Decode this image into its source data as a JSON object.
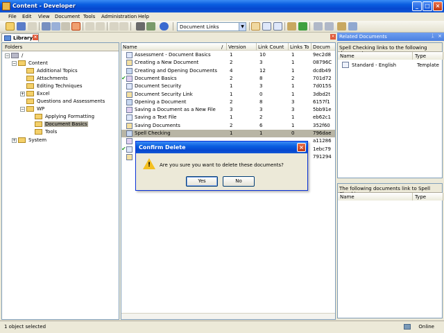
{
  "window": {
    "title": "Content - Developer",
    "controls": {
      "minimize": "_",
      "maximize": "□",
      "close": "×"
    }
  },
  "menu": [
    "File",
    "Edit",
    "View",
    "Document",
    "Tools",
    "Administration",
    "Help"
  ],
  "toolbar": {
    "view_combo": "Document Links",
    "combo_arrow": "▼"
  },
  "library_tab": {
    "label": "Library",
    "close": "×"
  },
  "folders": {
    "header": "Folders",
    "items": [
      {
        "label": "/",
        "expander": "−"
      },
      {
        "label": "Content",
        "expander": "−"
      },
      {
        "label": "Additional Topics",
        "expander": ""
      },
      {
        "label": "Attachments",
        "expander": ""
      },
      {
        "label": "Editing Techniques",
        "expander": ""
      },
      {
        "label": "Excel",
        "expander": "+"
      },
      {
        "label": "Questions and Assessments",
        "expander": ""
      },
      {
        "label": "WP",
        "expander": "−"
      },
      {
        "label": "Applying Formatting",
        "expander": ""
      },
      {
        "label": "Document Basics",
        "expander": ""
      },
      {
        "label": "Tools",
        "expander": ""
      },
      {
        "label": "System",
        "expander": "+"
      }
    ],
    "selected": "Document Basics"
  },
  "documents": {
    "columns": [
      "Name",
      "Version",
      "Link Count",
      "Links To",
      "Docum"
    ],
    "sort_glyph": "/",
    "rows": [
      {
        "name": "Assessment - Document Basics",
        "version": "1",
        "link_count": "10",
        "links_to": "1",
        "doc": "9ec2d8",
        "checked": false
      },
      {
        "name": "Creating a New Document",
        "version": "2",
        "link_count": "3",
        "links_to": "1",
        "doc": "08796C",
        "checked": false
      },
      {
        "name": "Creating and Opening Documents",
        "version": "4",
        "link_count": "12",
        "links_to": "1",
        "doc": "dcdb49",
        "checked": false
      },
      {
        "name": "Document Basics",
        "version": "2",
        "link_count": "8",
        "links_to": "2",
        "doc": "701d72",
        "checked": true
      },
      {
        "name": "Document Security",
        "version": "1",
        "link_count": "3",
        "links_to": "1",
        "doc": "7d015S",
        "checked": false
      },
      {
        "name": "Document Security Link",
        "version": "1",
        "link_count": "0",
        "links_to": "1",
        "doc": "3dbd2t",
        "checked": false
      },
      {
        "name": "Opening a Document",
        "version": "2",
        "link_count": "8",
        "links_to": "3",
        "doc": "6157f1",
        "checked": false
      },
      {
        "name": "Saving a Document as a New File",
        "version": "3",
        "link_count": "3",
        "links_to": "3",
        "doc": "5bb91e",
        "checked": false
      },
      {
        "name": "Saving a Text File",
        "version": "1",
        "link_count": "2",
        "links_to": "1",
        "doc": "eb62c1",
        "checked": false
      },
      {
        "name": "Saving Documents",
        "version": "2",
        "link_count": "6",
        "links_to": "1",
        "doc": "352f60",
        "checked": false
      },
      {
        "name": "Spell Checking",
        "version": "1",
        "link_count": "1",
        "links_to": "0",
        "doc": "796dae",
        "checked": false
      },
      {
        "name": "",
        "version": "",
        "link_count": "",
        "links_to": "",
        "doc": "a11286",
        "checked": false
      },
      {
        "name": "",
        "version": "",
        "link_count": "",
        "links_to": "",
        "doc": "1ebc79",
        "checked": true
      },
      {
        "name": "",
        "version": "",
        "link_count": "",
        "links_to": "",
        "doc": "791294",
        "checked": false
      }
    ]
  },
  "related": {
    "title": "Related Documents",
    "pin": "ᛣ",
    "close": "×",
    "top_caption": "Spell Checking links to the following documents:",
    "columns": [
      "Name",
      "Type"
    ],
    "items": [
      {
        "name": "Standard - English",
        "type": "Template"
      }
    ],
    "bottom_caption": "The following documents link to Spell Checking:",
    "bottom_columns": [
      "Name",
      "Type"
    ]
  },
  "status": {
    "text": "1 object selected",
    "online": "Online"
  },
  "dialog": {
    "title": "Confirm Delete",
    "close": "×",
    "icon_mark": "!",
    "message": "Are you sure you want to delete these documents?",
    "yes": "Yes",
    "no": "No"
  }
}
